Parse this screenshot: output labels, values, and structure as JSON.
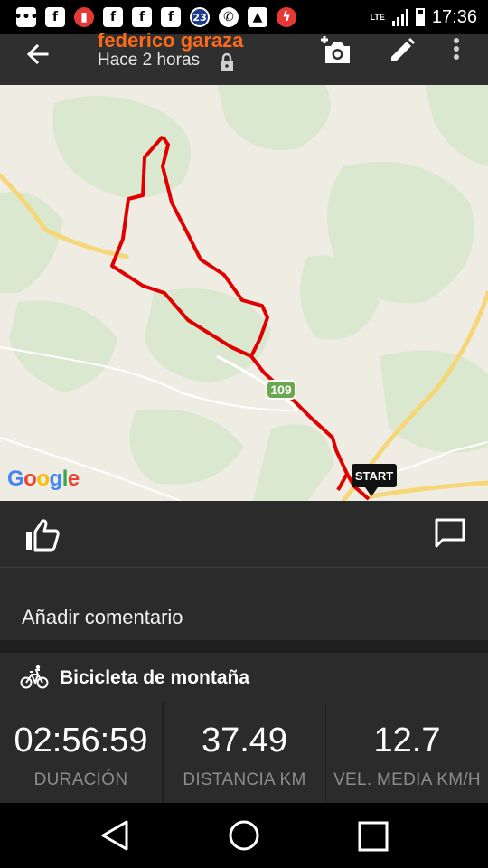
{
  "status_bar": {
    "time": "17:36",
    "notification_icons": [
      "chat-icon",
      "facebook-icon",
      "app-icon",
      "facebook-icon",
      "facebook-icon",
      "facebook-icon",
      "calendar-badge-icon",
      "whatsapp-icon",
      "gallery-icon",
      "flash-app-icon"
    ],
    "badge_number": "23",
    "network": "LTE"
  },
  "header": {
    "user_name": "federico garaza",
    "time_ago": "Hace 2 horas",
    "accent_color": "#ff6a1a"
  },
  "map": {
    "route_color": "#e00000",
    "road_badge": "109",
    "start_label": "START",
    "attribution": "Google"
  },
  "comment": {
    "placeholder": "Añadir comentario"
  },
  "activity": {
    "type": "Bicicleta de montaña"
  },
  "stats": [
    {
      "value": "02:56:59",
      "label": "DURACIÓN"
    },
    {
      "value": "37.49",
      "label": "DISTANCIA KM"
    },
    {
      "value": "12.7",
      "label": "VEL. MEDIA KM/H"
    }
  ]
}
